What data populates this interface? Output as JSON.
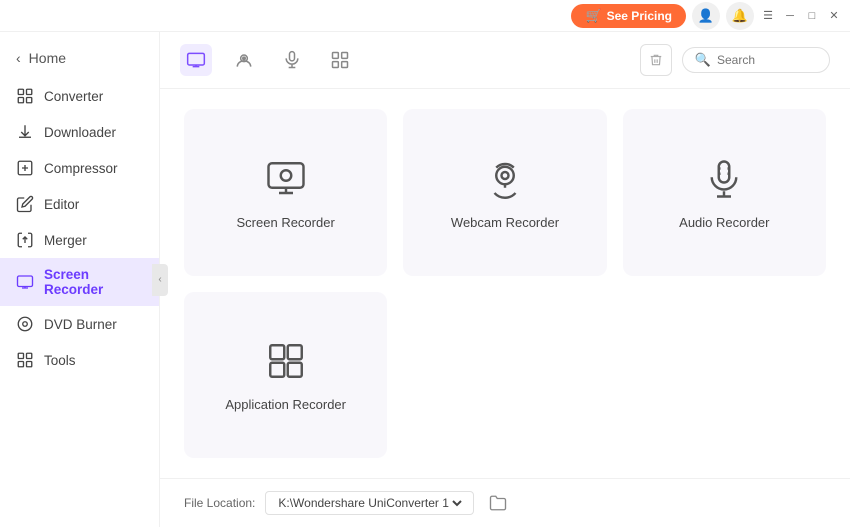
{
  "titlebar": {
    "pricing_label": "See Pricing",
    "cart_icon": "🛒",
    "user_icon": "👤",
    "bell_icon": "🔔",
    "menu_icon": "☰",
    "minimize_icon": "─",
    "maximize_icon": "□",
    "close_icon": "✕"
  },
  "sidebar": {
    "back_label": "Home",
    "items": [
      {
        "id": "converter",
        "label": "Converter"
      },
      {
        "id": "downloader",
        "label": "Downloader"
      },
      {
        "id": "compressor",
        "label": "Compressor"
      },
      {
        "id": "editor",
        "label": "Editor"
      },
      {
        "id": "merger",
        "label": "Merger"
      },
      {
        "id": "screen-recorder",
        "label": "Screen Recorder",
        "active": true
      },
      {
        "id": "dvd-burner",
        "label": "DVD Burner"
      },
      {
        "id": "tools",
        "label": "Tools"
      }
    ]
  },
  "toolbar": {
    "tabs": [
      {
        "id": "screen",
        "label": "Screen Recorder",
        "active": true
      },
      {
        "id": "webcam",
        "label": "Webcam Recorder"
      },
      {
        "id": "audio",
        "label": "Audio Recorder"
      },
      {
        "id": "app",
        "label": "Application Recorder"
      }
    ],
    "search_placeholder": "Search"
  },
  "recorders": [
    {
      "id": "screen",
      "label": "Screen Recorder"
    },
    {
      "id": "webcam",
      "label": "Webcam Recorder"
    },
    {
      "id": "audio",
      "label": "Audio Recorder"
    },
    {
      "id": "application",
      "label": "Application Recorder"
    }
  ],
  "file_location": {
    "label": "File Location:",
    "path": "K:\\Wondershare UniConverter 1"
  }
}
